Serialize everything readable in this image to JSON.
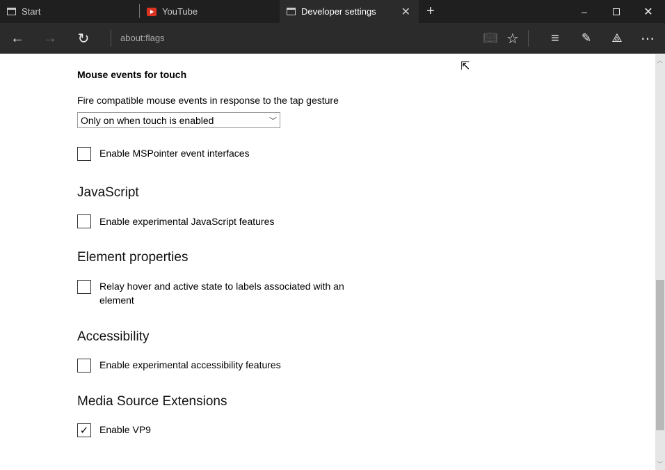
{
  "tabs": [
    {
      "label": "Start",
      "icon": "page-icon"
    },
    {
      "label": "YouTube",
      "icon": "youtube-icon"
    },
    {
      "label": "Developer settings",
      "icon": "page-icon",
      "active": true
    }
  ],
  "toolbar": {
    "address": "about:flags"
  },
  "content": {
    "mouse_heading": "Mouse events for touch",
    "mouse_desc": "Fire compatible mouse events in response to the tap gesture",
    "mouse_select": "Only on when touch is enabled",
    "mspointer": {
      "label": "Enable MSPointer event interfaces",
      "checked": false
    },
    "js_heading": "JavaScript",
    "js": {
      "label": "Enable experimental JavaScript features",
      "checked": false
    },
    "elem_heading": "Element properties",
    "elem": {
      "label": "Relay hover and active state to labels associated with an element",
      "checked": false
    },
    "acc_heading": "Accessibility",
    "acc": {
      "label": "Enable experimental accessibility features",
      "checked": false
    },
    "mse_heading": "Media Source Extensions",
    "vp9": {
      "label": "Enable VP9",
      "checked": true
    }
  }
}
